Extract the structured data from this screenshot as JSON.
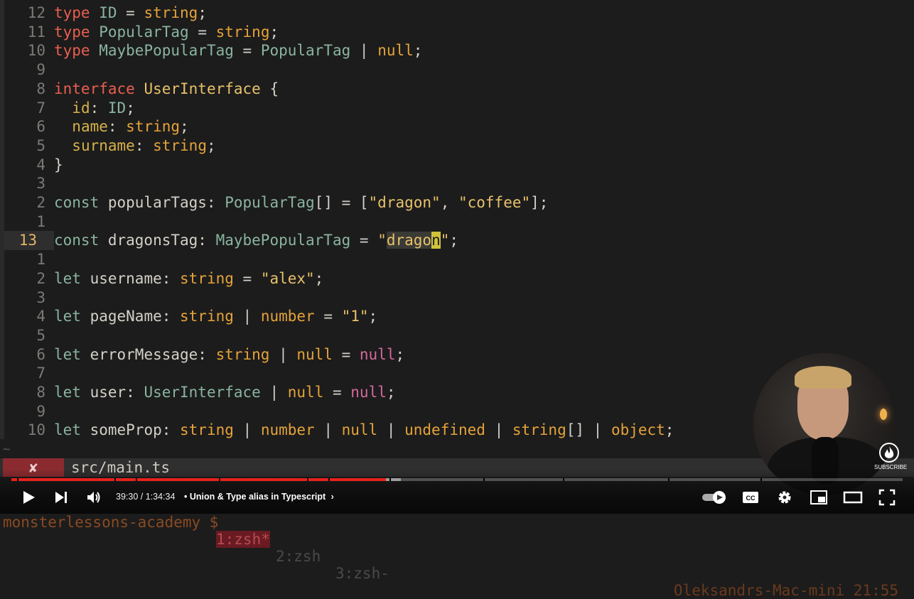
{
  "editor": {
    "lines": [
      {
        "num": "12",
        "tokens": [
          [
            "kw",
            "type"
          ],
          [
            "plain",
            " "
          ],
          [
            "type",
            "ID"
          ],
          [
            "plain",
            " = "
          ],
          [
            "prim",
            "string"
          ],
          [
            "plain",
            ";"
          ]
        ]
      },
      {
        "num": "11",
        "tokens": [
          [
            "kw",
            "type"
          ],
          [
            "plain",
            " "
          ],
          [
            "type",
            "PopularTag"
          ],
          [
            "plain",
            " = "
          ],
          [
            "prim",
            "string"
          ],
          [
            "plain",
            ";"
          ]
        ]
      },
      {
        "num": "10",
        "tokens": [
          [
            "kw",
            "type"
          ],
          [
            "plain",
            " "
          ],
          [
            "type",
            "MaybePopularTag"
          ],
          [
            "plain",
            " = "
          ],
          [
            "type",
            "PopularTag"
          ],
          [
            "plain",
            " | "
          ],
          [
            "prim",
            "null"
          ],
          [
            "plain",
            ";"
          ]
        ]
      },
      {
        "num": "9",
        "tokens": []
      },
      {
        "num": "8",
        "tokens": [
          [
            "kw",
            "interface"
          ],
          [
            "plain",
            " "
          ],
          [
            "str",
            "UserInterface"
          ],
          [
            "plain",
            " {"
          ]
        ]
      },
      {
        "num": "7",
        "tokens": [
          [
            "plain",
            "  "
          ],
          [
            "prop",
            "id"
          ],
          [
            "plain",
            ": "
          ],
          [
            "type",
            "ID"
          ],
          [
            "plain",
            ";"
          ]
        ]
      },
      {
        "num": "6",
        "tokens": [
          [
            "plain",
            "  "
          ],
          [
            "prop",
            "name"
          ],
          [
            "plain",
            ": "
          ],
          [
            "prim",
            "string"
          ],
          [
            "plain",
            ";"
          ]
        ]
      },
      {
        "num": "5",
        "tokens": [
          [
            "plain",
            "  "
          ],
          [
            "prop",
            "surname"
          ],
          [
            "plain",
            ": "
          ],
          [
            "prim",
            "string"
          ],
          [
            "plain",
            ";"
          ]
        ]
      },
      {
        "num": "4",
        "tokens": [
          [
            "plain",
            "}"
          ]
        ]
      },
      {
        "num": "3",
        "tokens": []
      },
      {
        "num": "2",
        "tokens": [
          [
            "type",
            "const"
          ],
          [
            "plain",
            " popularTags: "
          ],
          [
            "type",
            "PopularTag"
          ],
          [
            "plain",
            "[] = ["
          ],
          [
            "str",
            "\"dragon\""
          ],
          [
            "plain",
            ", "
          ],
          [
            "str",
            "\"coffee\""
          ],
          [
            "plain",
            "];"
          ]
        ]
      },
      {
        "num": "1",
        "tokens": []
      },
      {
        "num": "13",
        "current": true,
        "tokens": [
          [
            "type",
            "const"
          ],
          [
            "plain",
            " dragonsTag: "
          ],
          [
            "type",
            "MaybePopularTag"
          ],
          [
            "plain",
            " = "
          ],
          [
            "str",
            "\""
          ],
          [
            "match",
            "drago"
          ],
          [
            "cursor",
            "n"
          ],
          [
            "str",
            "\""
          ],
          [
            "plain",
            ";"
          ]
        ]
      },
      {
        "num": "1",
        "tokens": []
      },
      {
        "num": "2",
        "tokens": [
          [
            "type",
            "let"
          ],
          [
            "plain",
            " username: "
          ],
          [
            "prim",
            "string"
          ],
          [
            "plain",
            " = "
          ],
          [
            "str",
            "\"alex\""
          ],
          [
            "plain",
            ";"
          ]
        ]
      },
      {
        "num": "3",
        "tokens": []
      },
      {
        "num": "4",
        "tokens": [
          [
            "type",
            "let"
          ],
          [
            "plain",
            " pageName: "
          ],
          [
            "prim",
            "string"
          ],
          [
            "plain",
            " | "
          ],
          [
            "prim",
            "number"
          ],
          [
            "plain",
            " = "
          ],
          [
            "str",
            "\"1\""
          ],
          [
            "plain",
            ";"
          ]
        ]
      },
      {
        "num": "5",
        "tokens": []
      },
      {
        "num": "6",
        "tokens": [
          [
            "type",
            "let"
          ],
          [
            "plain",
            " errorMessage: "
          ],
          [
            "prim",
            "string"
          ],
          [
            "plain",
            " | "
          ],
          [
            "prim",
            "null"
          ],
          [
            "plain",
            " = "
          ],
          [
            "nul",
            "null"
          ],
          [
            "plain",
            ";"
          ]
        ]
      },
      {
        "num": "7",
        "tokens": []
      },
      {
        "num": "8",
        "tokens": [
          [
            "type",
            "let"
          ],
          [
            "plain",
            " user: "
          ],
          [
            "type",
            "UserInterface"
          ],
          [
            "plain",
            " | "
          ],
          [
            "prim",
            "null"
          ],
          [
            "plain",
            " = "
          ],
          [
            "nul",
            "null"
          ],
          [
            "plain",
            ";"
          ]
        ]
      },
      {
        "num": "9",
        "tokens": []
      },
      {
        "num": "10",
        "tokens": [
          [
            "type",
            "let"
          ],
          [
            "plain",
            " someProp: "
          ],
          [
            "prim",
            "string"
          ],
          [
            "plain",
            " | "
          ],
          [
            "prim",
            "number"
          ],
          [
            "plain",
            " | "
          ],
          [
            "prim",
            "null"
          ],
          [
            "plain",
            " | "
          ],
          [
            "prim",
            "undefined"
          ],
          [
            "plain",
            " | "
          ],
          [
            "prim",
            "string"
          ],
          [
            "plain",
            "[] | "
          ],
          [
            "prim",
            "object"
          ],
          [
            "plain",
            ";"
          ]
        ]
      }
    ],
    "tilde": "~"
  },
  "statusbar": {
    "error_mark": "✘",
    "file": "src/main.ts"
  },
  "tmux": {
    "session": "monsterlessons-academy $",
    "win1": "1:zsh*",
    "win2": "2:zsh",
    "win3": "3:zsh-",
    "host": "Oleksandrs-Mac-mini 21:55"
  },
  "player": {
    "time": "39:30 / 1:34:34",
    "chapter_sep": "•",
    "chapter": "Union & Type alias in Typescript",
    "chapter_arrow": "›",
    "progress": 0.42,
    "buffered": 0.437,
    "subscribe_label": "SUBSCRIBE",
    "cc_label": "CC",
    "icons": [
      "play-icon",
      "next-icon",
      "volume-icon",
      "autoplay-toggle-icon",
      "captions-icon",
      "settings-icon",
      "miniplayer-icon",
      "theater-icon",
      "fullscreen-icon"
    ]
  },
  "colors": {
    "keyword": "#e95f4f",
    "type": "#8ab4a0",
    "string": "#e8c16a",
    "primitive": "#e5a33a",
    "null": "#d4699c",
    "progress": "#e8211c"
  }
}
